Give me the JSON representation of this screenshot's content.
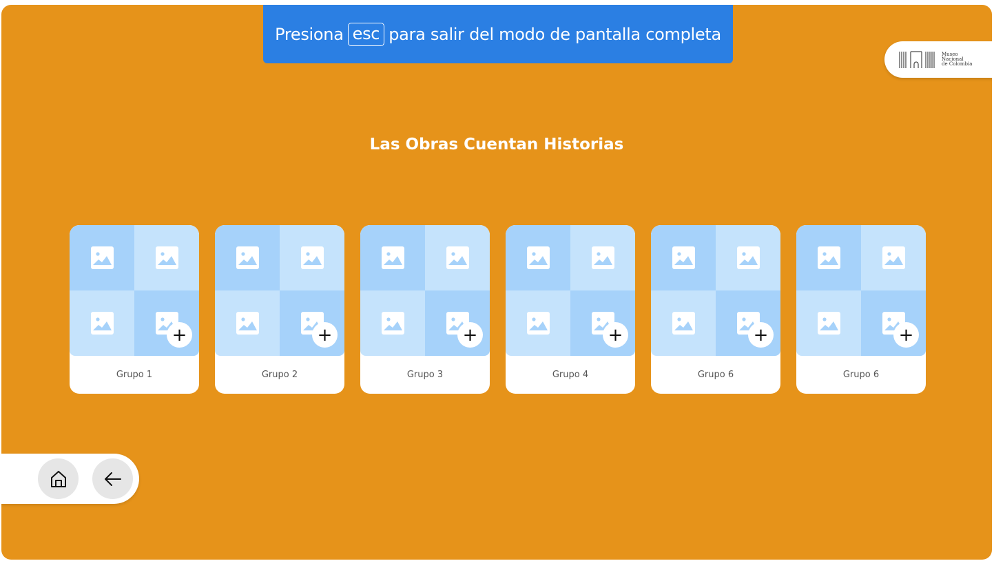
{
  "fullscreen_banner": {
    "before": "Presiona",
    "key": "esc",
    "after": "para salir del modo de pantalla completa"
  },
  "logo": {
    "line1": "Museo",
    "line2": "Nacional",
    "line3": "de Colombia"
  },
  "page_title": "Las Obras Cuentan Historias",
  "groups": [
    {
      "label": "Grupo 1"
    },
    {
      "label": "Grupo 2"
    },
    {
      "label": "Grupo 3"
    },
    {
      "label": "Grupo 4"
    },
    {
      "label": "Grupo 6"
    },
    {
      "label": "Grupo 6"
    }
  ],
  "add_symbol": "+",
  "icons": {
    "placeholder": "image-icon",
    "add": "plus-icon",
    "home": "home-icon",
    "back": "arrow-left-icon"
  },
  "colors": {
    "background": "#E6931A",
    "banner": "#2B7FE3",
    "tile_dark": "#A6D2FA",
    "tile_light": "#C5E3FC"
  }
}
